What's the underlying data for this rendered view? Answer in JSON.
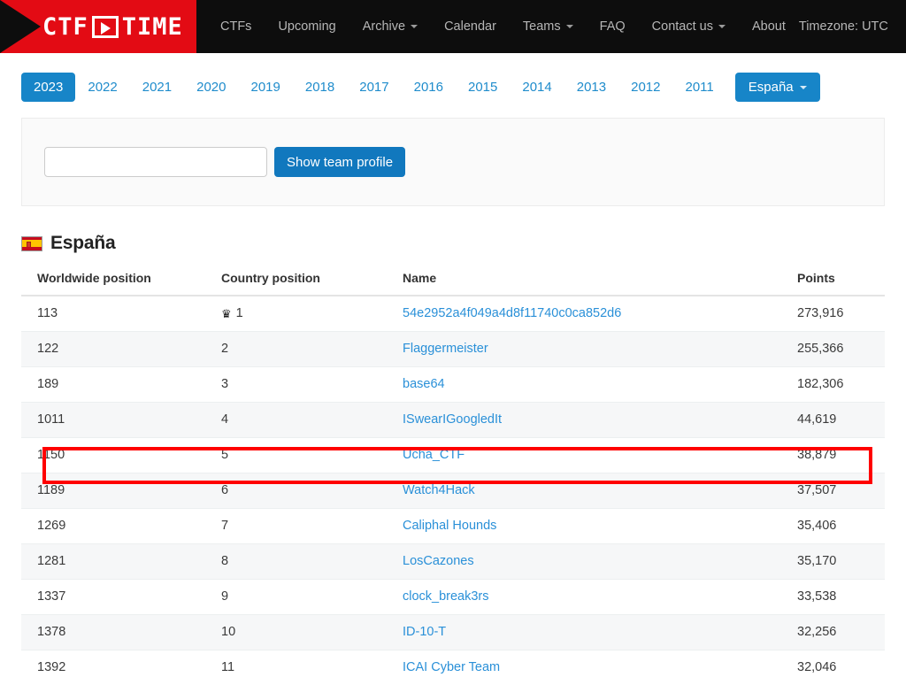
{
  "brand": {
    "logo_left": "CTF",
    "logo_right": "TIME",
    "logo_icon": "play-box-icon",
    "color_red": "#e30b14",
    "color_blue": "#1785c8",
    "color_link": "#2a90d8",
    "color_highlight": "#ff0000"
  },
  "nav": {
    "items": [
      {
        "label": "CTFs",
        "caret": false
      },
      {
        "label": "Upcoming",
        "caret": false
      },
      {
        "label": "Archive",
        "caret": true
      },
      {
        "label": "Calendar",
        "caret": false
      },
      {
        "label": "Teams",
        "caret": true
      },
      {
        "label": "FAQ",
        "caret": false
      },
      {
        "label": "Contact us",
        "caret": true
      },
      {
        "label": "About",
        "caret": false
      }
    ],
    "timezone": "Timezone: UTC"
  },
  "year_tabs": {
    "years": [
      "2023",
      "2022",
      "2021",
      "2020",
      "2019",
      "2018",
      "2017",
      "2016",
      "2015",
      "2014",
      "2013",
      "2012",
      "2011"
    ],
    "active": "2023",
    "country_selector": "España"
  },
  "search_panel": {
    "team_input_value": "",
    "team_input_placeholder": "",
    "show_button": "Show team profile"
  },
  "country_heading": {
    "flag": "spain-flag-icon",
    "title": "España"
  },
  "table": {
    "columns": [
      "Worldwide position",
      "Country position",
      "Name",
      "Points"
    ],
    "rows": [
      {
        "worldwide": "113",
        "country": "1",
        "crown": true,
        "name": "54e2952a4f049a4d8f11740c0ca852d6",
        "points": "273,916",
        "highlighted": false
      },
      {
        "worldwide": "122",
        "country": "2",
        "crown": false,
        "name": "Flaggermeister",
        "points": "255,366",
        "highlighted": false
      },
      {
        "worldwide": "189",
        "country": "3",
        "crown": false,
        "name": "base64",
        "points": "182,306",
        "highlighted": false
      },
      {
        "worldwide": "1011",
        "country": "4",
        "crown": false,
        "name": "ISwearIGoogledIt",
        "points": "44,619",
        "highlighted": false
      },
      {
        "worldwide": "1150",
        "country": "5",
        "crown": false,
        "name": "Ucha_CTF",
        "points": "38,879",
        "highlighted": true
      },
      {
        "worldwide": "1189",
        "country": "6",
        "crown": false,
        "name": "Watch4Hack",
        "points": "37,507",
        "highlighted": false
      },
      {
        "worldwide": "1269",
        "country": "7",
        "crown": false,
        "name": "Caliphal Hounds",
        "points": "35,406",
        "highlighted": false
      },
      {
        "worldwide": "1281",
        "country": "8",
        "crown": false,
        "name": "LosCazones",
        "points": "35,170",
        "highlighted": false
      },
      {
        "worldwide": "1337",
        "country": "9",
        "crown": false,
        "name": "clock_break3rs",
        "points": "33,538",
        "highlighted": false
      },
      {
        "worldwide": "1378",
        "country": "10",
        "crown": false,
        "name": "ID-10-T",
        "points": "32,256",
        "highlighted": false
      },
      {
        "worldwide": "1392",
        "country": "11",
        "crown": false,
        "name": "ICAI Cyber Team",
        "points": "32,046",
        "highlighted": false
      }
    ],
    "crown_glyph": "♛"
  }
}
